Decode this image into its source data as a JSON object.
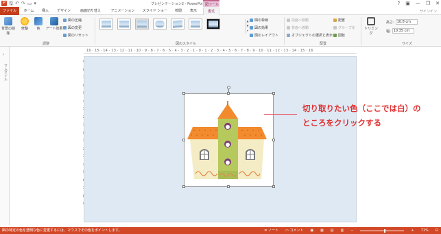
{
  "window": {
    "title": "プレゼンテーション2 - PowerPoint",
    "context_group": "図ツール",
    "qat_icons": [
      "powerpoint-logo",
      "save-icon",
      "undo-icon",
      "redo-icon",
      "start-slideshow-icon",
      "customize-qat-icon"
    ],
    "controls": [
      "?",
      "▣",
      "—",
      "❐",
      "✕"
    ]
  },
  "tabs": [
    {
      "label": "ファイル",
      "kind": "file"
    },
    {
      "label": "ホーム"
    },
    {
      "label": "挿入"
    },
    {
      "label": "デザイン"
    },
    {
      "label": "画面切り替え"
    },
    {
      "label": "アニメーション"
    },
    {
      "label": "スライド ショー"
    },
    {
      "label": "校閲"
    },
    {
      "label": "表示"
    },
    {
      "label": "書式",
      "active": true
    }
  ],
  "signin": "サインイン",
  "ribbon": {
    "adjust": {
      "label": "調整",
      "remove_bg": "背景の削除",
      "corrections": "修整",
      "color": "色",
      "artistic": "アート効果",
      "compress": "図の圧縮",
      "change": "図の変更",
      "reset": "図のリセット"
    },
    "picture_styles": {
      "label": "図のスタイル",
      "border": "図の枠線",
      "effects": "図の効果",
      "layout": "図のレイアウト"
    },
    "arrange": {
      "label": "配置",
      "bring_forward": "前面へ移動",
      "send_backward": "背面へ移動",
      "selection_pane": "オブジェクトの選択と表示",
      "align": "配置",
      "group": "グループ化",
      "rotate": "回転"
    },
    "size": {
      "label": "サイズ",
      "crop": "トリミング",
      "height_label": "高さ:",
      "height_value": "10.8 cm",
      "width_label": "幅:",
      "width_value": "10.35 cm"
    }
  },
  "ruler": {
    "h": "16 · 15 · 14 · 13 · 12 · 11 · 10 · 9 · 8 · 7 · 6 · 5 · 4 · 3 · 2 · 1 · 0 · 1 · 2 · 3 · 4 · 5 · 6 · 7 · 8 · 9 · 10 · 11 · 12 · 13 · 14 · 15 · 16",
    "v": [
      "9",
      "8",
      "7",
      "6",
      "5",
      "4",
      "3",
      "2",
      "1",
      "0",
      "1",
      "2",
      "3",
      "4",
      "5",
      "6",
      "7",
      "8",
      "9"
    ]
  },
  "thumbnail_pane": "サムネイル",
  "callout": {
    "line1": "切り取りたい色（ここでは白）の",
    "line2": "ところをクリックする"
  },
  "status": {
    "message": "図の特定の色を透明な色に変更するには、マウスでその色をポイントします。",
    "notes": "ノート",
    "comments": "コメント",
    "zoom": "71%",
    "zoom_level": 0.55
  },
  "colors": {
    "accent": "#d24726",
    "format_tab": "#8a2c5e",
    "callout": "#e03030",
    "slide_bg": "#dfe9f3"
  }
}
